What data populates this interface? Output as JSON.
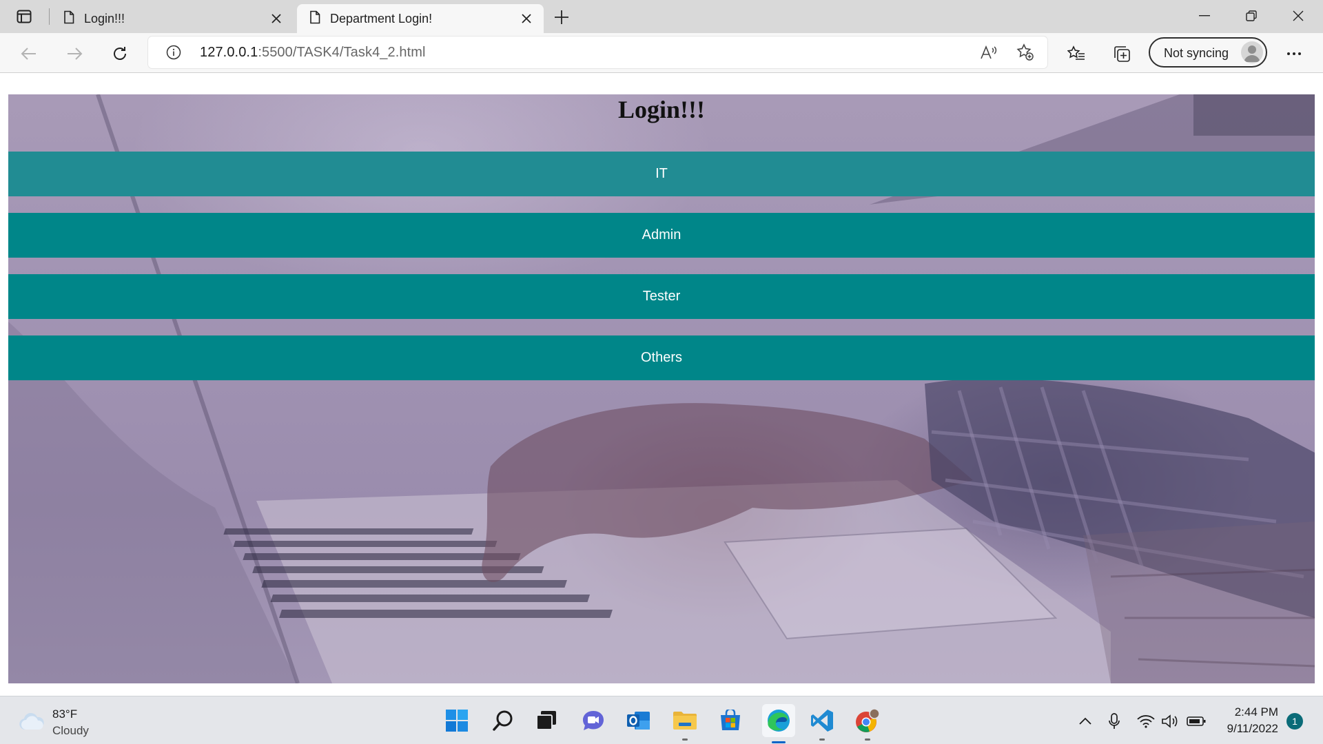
{
  "browser": {
    "tabs": [
      {
        "title": "Login!!!",
        "active": false
      },
      {
        "title": "Department Login!",
        "active": true
      }
    ],
    "url_host": "127.0.0.1",
    "url_path": ":5500/TASK4/Task4_2.html",
    "profile_status": "Not syncing"
  },
  "page": {
    "heading": "Login!!!",
    "departments": [
      {
        "label": "IT",
        "state": "hover"
      },
      {
        "label": "Admin",
        "state": "normal"
      },
      {
        "label": "Tester",
        "state": "normal"
      },
      {
        "label": "Others",
        "state": "normal"
      }
    ],
    "colors": {
      "button": "#008689",
      "button_hover": "#218c93",
      "overlay": "#a89ab7"
    }
  },
  "taskbar": {
    "weather_temp": "83°F",
    "weather_condition": "Cloudy",
    "time": "2:44 PM",
    "date": "9/11/2022",
    "notification_count": "1",
    "pinned_apps": [
      "start-icon",
      "search-icon",
      "task-view-icon",
      "teams-chat-icon",
      "outlook-icon",
      "file-explorer-icon",
      "microsoft-store-icon",
      "edge-icon",
      "vscode-icon",
      "chrome-icon"
    ]
  }
}
